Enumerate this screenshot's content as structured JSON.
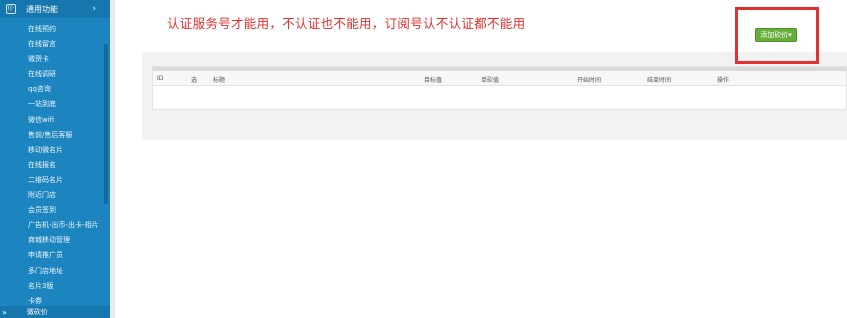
{
  "sidebar": {
    "header_label": "通用功能",
    "icons": {
      "header": "wifi-box-icon",
      "chevron": "chevron-right-icon",
      "expand": "double-chevron-icon"
    },
    "items": [
      "在线预约",
      "在线留言",
      "微贺卡",
      "在线调研",
      "qq咨询",
      "一站到底",
      "微信wifi",
      "售前/售后客服",
      "移动微名片",
      "在线报名",
      "二维码名片",
      "附近门店",
      "会员签到",
      "广告机-出币-出卡-相片",
      "商城移动管理",
      "申请推广员",
      "多门店地址",
      "名片3版",
      "卡券"
    ],
    "bottom_expand": "»",
    "bottom_label": "微砍价"
  },
  "main": {
    "notice": "认证服务号才能用，不认证也不能用，订阅号认不认证都不能用",
    "add_button_label": "添加砍价▾"
  },
  "table": {
    "columns": [
      "ID",
      "选",
      "标题",
      "目标值",
      "单砍值",
      "开始时间",
      "结束时间",
      "操作"
    ]
  },
  "colors": {
    "sidebar_bg": "#1c85bf",
    "notice": "#e0302f",
    "highlight_box": "#e0302f",
    "add_button": "#67ad3a"
  }
}
